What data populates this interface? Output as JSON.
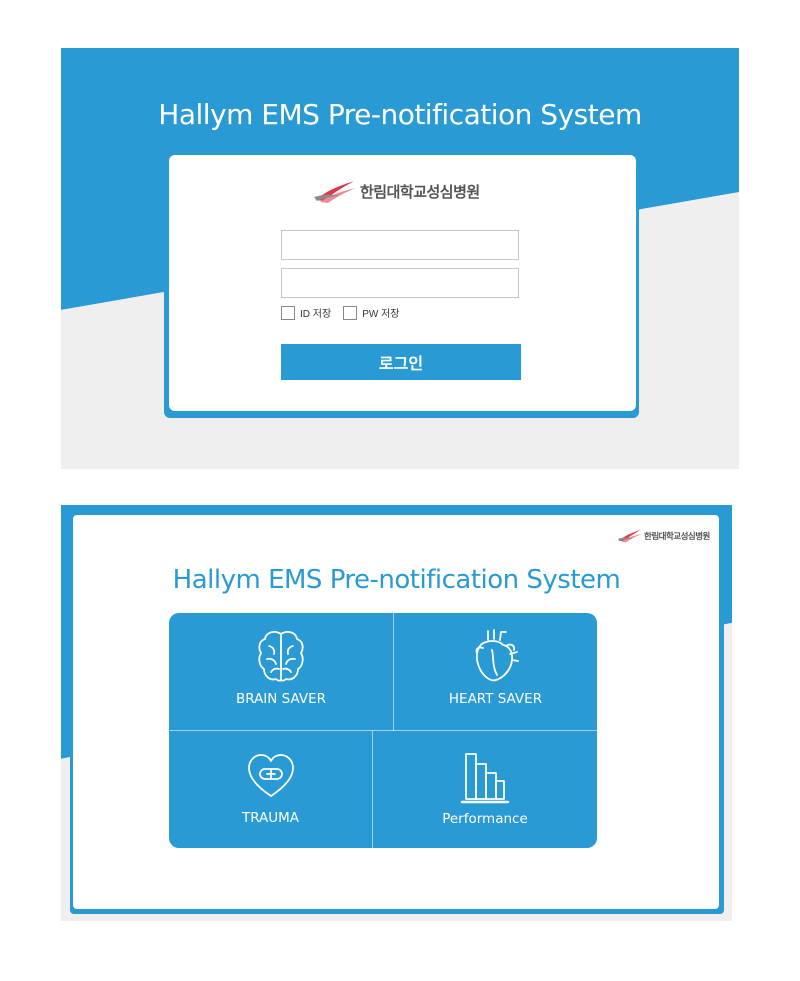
{
  "app_title": "Hallym EMS Pre-notification System",
  "hospital_name": "한림대학교성심병원",
  "login": {
    "id_input": {
      "value": "",
      "placeholder": ""
    },
    "pw_input": {
      "value": "",
      "placeholder": ""
    },
    "save_id_label": "ID 저장",
    "save_pw_label": "PW 저장",
    "login_button": "로그인"
  },
  "menu": {
    "brain": "BRAIN SAVER",
    "heart": "HEART SAVER",
    "trauma": "TRAUMA",
    "performance": "Performance"
  },
  "icons": {
    "logo": "hallym-logo-icon",
    "brain": "brain-icon",
    "heart": "heart-organ-icon",
    "trauma": "heart-bandage-icon",
    "performance": "bar-chart-icon"
  },
  "colors": {
    "primary": "#2a9ad5",
    "panel_gray": "#efeff0",
    "logo_red": "#e0394a",
    "logo_gray": "#8a8a8a"
  }
}
